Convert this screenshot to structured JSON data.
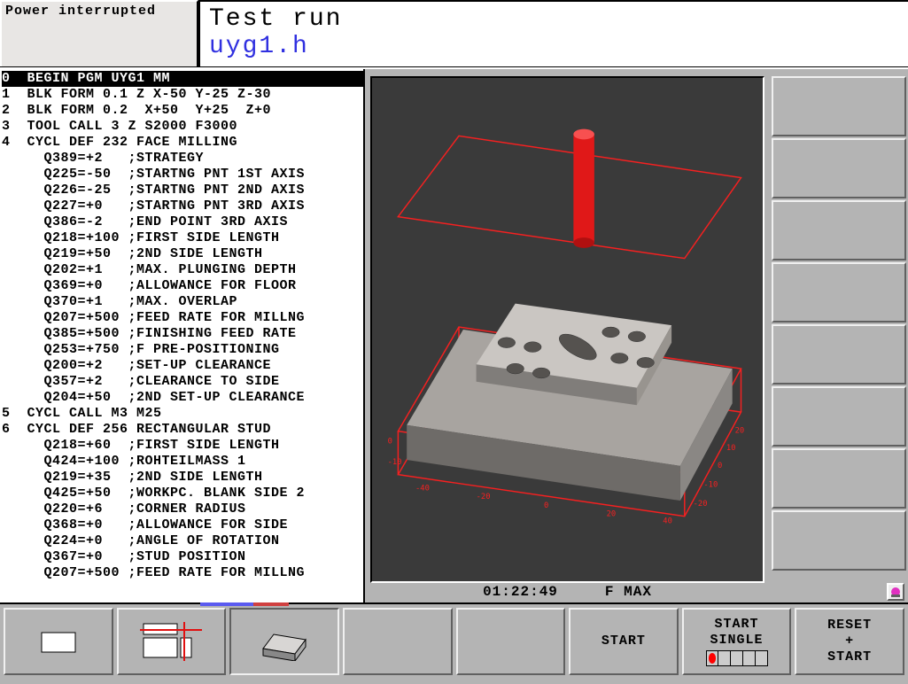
{
  "status": "Power interrupted",
  "mode": "Test run",
  "file": "uyg1.h",
  "time": "01:22:49",
  "feed": "F MAX",
  "code": [
    {
      "n": "0",
      "t": " BEGIN PGM UYG1 MM",
      "hl": true
    },
    {
      "n": "1",
      "t": " BLK FORM 0.1 Z X-50 Y-25 Z-30"
    },
    {
      "n": "2",
      "t": " BLK FORM 0.2  X+50  Y+25  Z+0"
    },
    {
      "n": "3",
      "t": " TOOL CALL 3 Z S2000 F3000"
    },
    {
      "n": "4",
      "t": " CYCL DEF 232 FACE MILLING"
    },
    {
      "n": "",
      "t": "   Q389=+2   ;STRATEGY"
    },
    {
      "n": "",
      "t": "   Q225=-50  ;STARTNG PNT 1ST AXIS"
    },
    {
      "n": "",
      "t": "   Q226=-25  ;STARTNG PNT 2ND AXIS"
    },
    {
      "n": "",
      "t": "   Q227=+0   ;STARTNG PNT 3RD AXIS"
    },
    {
      "n": "",
      "t": "   Q386=-2   ;END POINT 3RD AXIS"
    },
    {
      "n": "",
      "t": "   Q218=+100 ;FIRST SIDE LENGTH"
    },
    {
      "n": "",
      "t": "   Q219=+50  ;2ND SIDE LENGTH"
    },
    {
      "n": "",
      "t": "   Q202=+1   ;MAX. PLUNGING DEPTH"
    },
    {
      "n": "",
      "t": "   Q369=+0   ;ALLOWANCE FOR FLOOR"
    },
    {
      "n": "",
      "t": "   Q370=+1   ;MAX. OVERLAP"
    },
    {
      "n": "",
      "t": "   Q207=+500 ;FEED RATE FOR MILLNG"
    },
    {
      "n": "",
      "t": "   Q385=+500 ;FINISHING FEED RATE"
    },
    {
      "n": "",
      "t": "   Q253=+750 ;F PRE-POSITIONING"
    },
    {
      "n": "",
      "t": "   Q200=+2   ;SET-UP CLEARANCE"
    },
    {
      "n": "",
      "t": "   Q357=+2   ;CLEARANCE TO SIDE"
    },
    {
      "n": "",
      "t": "   Q204=+50  ;2ND SET-UP CLEARANCE"
    },
    {
      "n": "5",
      "t": " CYCL CALL M3 M25"
    },
    {
      "n": "6",
      "t": " CYCL DEF 256 RECTANGULAR STUD"
    },
    {
      "n": "",
      "t": "   Q218=+60  ;FIRST SIDE LENGTH"
    },
    {
      "n": "",
      "t": "   Q424=+100 ;ROHTEILMASS 1"
    },
    {
      "n": "",
      "t": "   Q219=+35  ;2ND SIDE LENGTH"
    },
    {
      "n": "",
      "t": "   Q425=+50  ;WORKPC. BLANK SIDE 2"
    },
    {
      "n": "",
      "t": "   Q220=+6   ;CORNER RADIUS"
    },
    {
      "n": "",
      "t": "   Q368=+0   ;ALLOWANCE FOR SIDE"
    },
    {
      "n": "",
      "t": "   Q224=+0   ;ANGLE OF ROTATION"
    },
    {
      "n": "",
      "t": "   Q367=+0   ;STUD POSITION"
    },
    {
      "n": "",
      "t": "   Q207=+500 ;FEED RATE FOR MILLNG"
    }
  ],
  "softkeys": {
    "start": "START",
    "start_single": "START\nSINGLE",
    "reset_start": "RESET\n+\nSTART"
  }
}
